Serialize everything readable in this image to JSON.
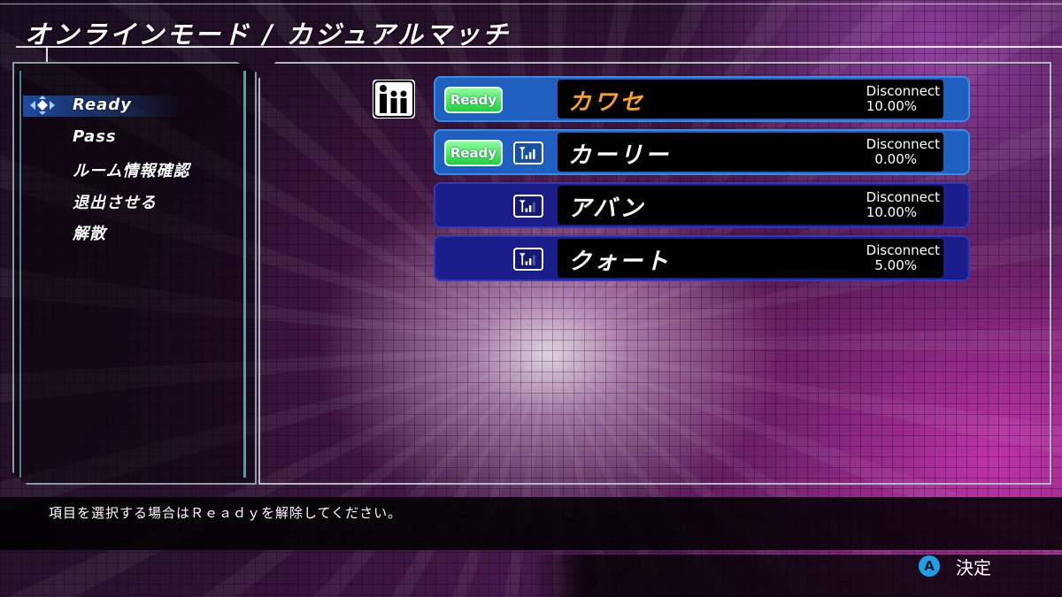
{
  "header": {
    "title": "オンラインモード / カジュアルマッチ"
  },
  "menu": {
    "items": [
      {
        "label": "Ready",
        "selected": true
      },
      {
        "label": "Pass"
      },
      {
        "label": "ルーム情報確認"
      },
      {
        "label": "退出させる"
      },
      {
        "label": "解散"
      }
    ]
  },
  "players": [
    {
      "name": "カワセ",
      "ready": "Ready",
      "disconnect_label": "Disconnect",
      "disconnect_rate": "10.00%",
      "is_self": true,
      "is_host": true
    },
    {
      "name": "カーリー",
      "ready": "Ready",
      "disconnect_label": "Disconnect",
      "disconnect_rate": "0.00%",
      "is_self": true,
      "signal_icon": "signal-icon"
    },
    {
      "name": "アバン",
      "ready": "",
      "disconnect_label": "Disconnect",
      "disconnect_rate": "10.00%",
      "is_self": false,
      "signal_icon": "signal-icon"
    },
    {
      "name": "クォート",
      "ready": "",
      "disconnect_label": "Disconnect",
      "disconnect_rate": "5.00%",
      "is_self": false,
      "signal_icon": "signal-icon"
    }
  ],
  "help": {
    "text": "項目を選択する場合はＲｅａｄｙを解除してください。"
  },
  "controls": {
    "button": "A",
    "confirm_label": "決定"
  },
  "colors": {
    "host_name": "#f7a028",
    "ready_green": "#1fcf3c",
    "self_row": "#1f5fbf",
    "other_row": "#1a1d8a",
    "a_button": "#1ea0e6"
  }
}
